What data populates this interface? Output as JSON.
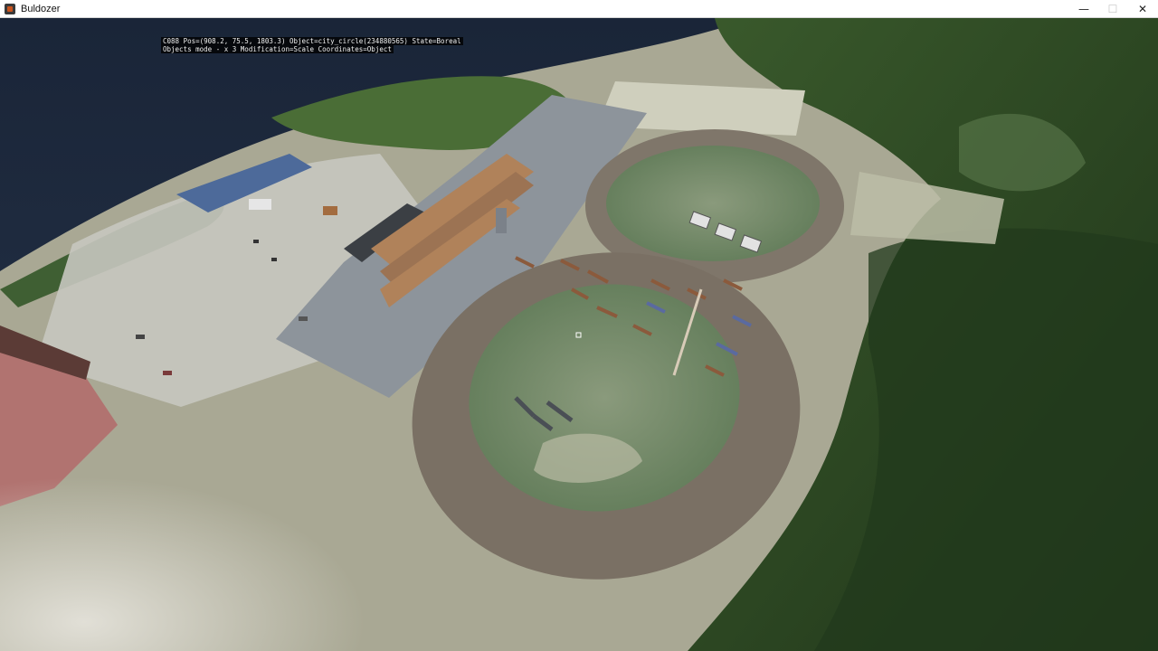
{
  "window": {
    "title": "Buldozer",
    "controls": {
      "minimize": "—",
      "maximize": "☐",
      "close": "✕"
    }
  },
  "hud": {
    "line1": "C088 Pos=(908.2, 75.5, 1803.3) Object=city_circle(234880565) State=Boreal",
    "line2": "Objects mode - x 3 Modification=Scale Coordinates=Object"
  },
  "colors": {
    "sea": "#1d2a3c",
    "forest": "#2d4a24",
    "terrain_light": "#b9b7a5",
    "track": "#7d7368",
    "infield": "#6f8566",
    "concrete": "#8a929a"
  },
  "scene": {
    "terrain": "satellite-terrain",
    "tracks": [
      "small-oval-track",
      "large-oval-track"
    ],
    "objects": [
      "grandstands",
      "parking-lot",
      "vehicles",
      "fences",
      "light-pole",
      "trailers"
    ]
  }
}
